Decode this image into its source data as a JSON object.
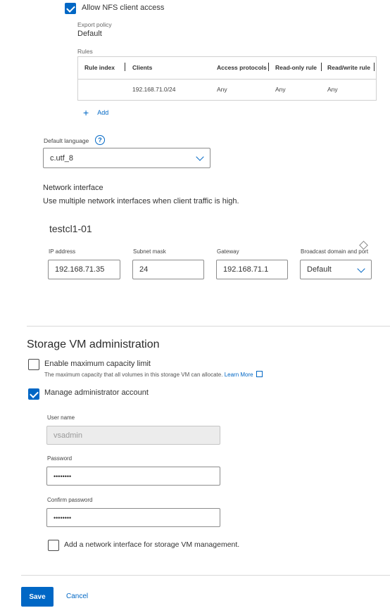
{
  "nfs": {
    "allow_label": "Allow NFS client access",
    "export_policy_label": "Export policy",
    "export_policy_value": "Default",
    "rules_label": "Rules",
    "columns": [
      "Rule index",
      "Clients",
      "Access protocols",
      "Read-only rule",
      "Read/write rule"
    ],
    "rows": [
      {
        "index": "",
        "clients": "192.168.71.0/24",
        "protocols": "Any",
        "read_only": "Any",
        "read_write": "Any"
      }
    ],
    "add_label": "Add"
  },
  "language": {
    "label": "Default language",
    "value": "c.utf_8"
  },
  "network": {
    "title": "Network interface",
    "description": "Use multiple network interfaces when client traffic is high.",
    "node": "testcl1-01",
    "fields": {
      "ip_label": "IP address",
      "ip_value": "192.168.71.35",
      "subnet_label": "Subnet mask",
      "subnet_value": "24",
      "gateway_label": "Gateway",
      "gateway_value": "192.168.71.1",
      "broadcast_label": "Broadcast domain and port",
      "broadcast_value": "Default"
    }
  },
  "admin": {
    "title": "Storage VM administration",
    "capacity_label": "Enable maximum capacity limit",
    "capacity_help": "The maximum capacity that all volumes in this storage VM can allocate.",
    "learn_more": "Learn More",
    "manage_label": "Manage administrator account",
    "username_label": "User name",
    "username_value": "vsadmin",
    "password_label": "Password",
    "password_value": "••••••••",
    "confirm_label": "Confirm password",
    "confirm_value": "••••••••",
    "mgmt_interface_label": "Add a network interface for storage VM management."
  },
  "footer": {
    "save": "Save",
    "cancel": "Cancel"
  },
  "colors": {
    "accent": "#0067c5"
  }
}
